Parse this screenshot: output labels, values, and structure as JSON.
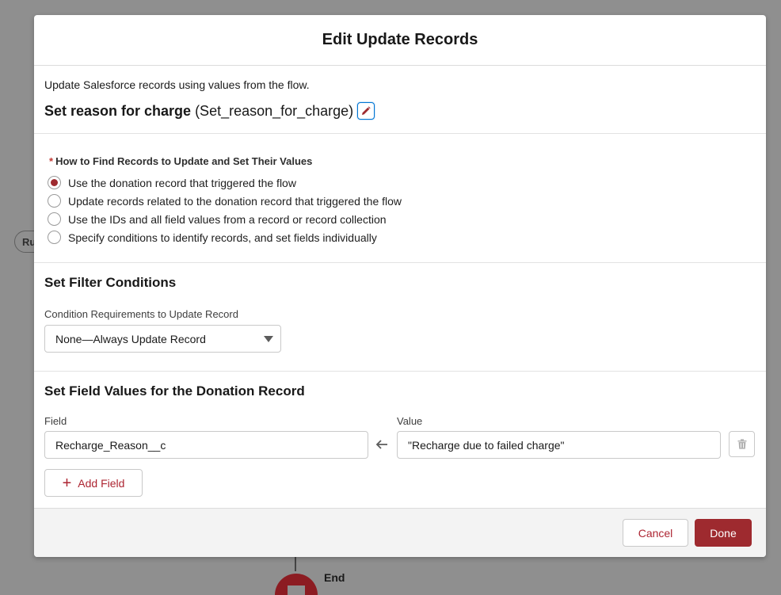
{
  "background": {
    "pill_label": "Ru",
    "end_label": "End"
  },
  "modal": {
    "title": "Edit Update Records",
    "description": "Update Salesforce records using values from the flow.",
    "element_label": "Set reason for charge",
    "element_api_name": "(Set_reason_for_charge)",
    "find_records": {
      "required_marker": "*",
      "heading": "How to Find Records to Update and Set Their Values",
      "options": [
        {
          "label": "Use the donation record that triggered the flow",
          "checked": true
        },
        {
          "label": "Update records related to the donation record that triggered the flow",
          "checked": false
        },
        {
          "label": "Use the IDs and all field values from a record or record collection",
          "checked": false
        },
        {
          "label": "Specify conditions to identify records, and set fields individually",
          "checked": false
        }
      ]
    },
    "filter": {
      "title": "Set Filter Conditions",
      "condition_label": "Condition Requirements to Update Record",
      "condition_value": "None—Always Update Record"
    },
    "field_values": {
      "title": "Set Field Values for the Donation Record",
      "field_col_label": "Field",
      "value_col_label": "Value",
      "rows": [
        {
          "field": "Recharge_Reason__c",
          "value": "\"Recharge due to failed charge\""
        }
      ],
      "add_field_label": "Add Field"
    },
    "footer": {
      "cancel_label": "Cancel",
      "done_label": "Done"
    }
  },
  "colors": {
    "brand": "#9e2a2f",
    "link": "#ad2532",
    "focus": "#0176d3"
  },
  "icons": {
    "edit": "pencil-icon",
    "arrow": "arrow-left-icon",
    "delete": "trash-icon",
    "add": "plus-icon",
    "dropdown": "chevron-down-icon"
  }
}
